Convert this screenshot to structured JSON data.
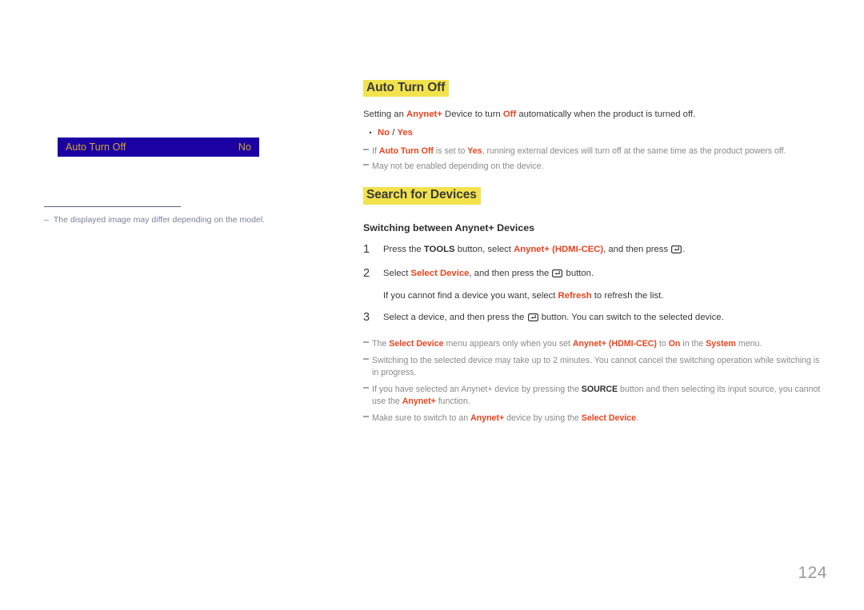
{
  "page": {
    "number": "124"
  },
  "osd_preview": {
    "row_label": "Auto Turn Off",
    "row_value": "No",
    "bg_color": "#1b01a3",
    "text_color": "#d2a829",
    "caption_dash": "–",
    "caption": "The displayed image may differ depending on the model."
  },
  "sections": {
    "auto_turn_off": {
      "heading": "Auto Turn Off",
      "intro": {
        "p1": "Setting an ",
        "a1": "Anynet+",
        "p2": " Device to turn ",
        "a2": "Off",
        "p3": " automatically when the product is turned off."
      },
      "options": {
        "bullet": "•",
        "first": "No",
        "sep": " / ",
        "second": "Yes"
      },
      "notes": [
        {
          "p1": "If ",
          "a1": "Auto Turn Off",
          "p2": " is set to ",
          "a2": "Yes",
          "p3": ", running external devices will turn off at the same time as the product powers off."
        },
        {
          "p1": "May not be enabled depending on the device.",
          "a1": "",
          "p2": "",
          "a2": "",
          "p3": ""
        }
      ]
    },
    "search_for_devices": {
      "heading": "Search for Devices",
      "subheading": "Switching between Anynet+ Devices",
      "steps": [
        {
          "num": "1",
          "p1": "Press the ",
          "b1": "TOOLS",
          "p2": " button, select ",
          "a1": "Anynet+ (HDMI-CEC)",
          "p3": ", and then press ",
          "icon": "enter-key-icon",
          "p4": "."
        },
        {
          "num": "2",
          "p1": "Select ",
          "b1": "",
          "p2": "",
          "a1": "Select Device",
          "p3": ", and then press the ",
          "icon": "enter-key-icon",
          "p4": " button."
        },
        {
          "num": "3",
          "p1": "Select a device, and then press the ",
          "b1": "",
          "p2": "",
          "a1": "",
          "p3": "",
          "icon": "enter-key-icon",
          "p4": " button. You can switch to the selected device."
        }
      ],
      "step2_sub": {
        "p1": "If you cannot find a device you want, select ",
        "a1": "Refresh",
        "p2": " to refresh the list."
      },
      "notes": [
        {
          "p1": "The ",
          "a1": "Select Device",
          "p2": " menu appears only when you set ",
          "a2": "Anynet+ (HDMI-CEC)",
          "p3": " to ",
          "a3": "On",
          "p4": " in the ",
          "a4": "System",
          "p5": " menu."
        },
        {
          "p1": "Switching to the selected device may take up to 2 minutes. You cannot cancel the switching operation while switching is in progress.",
          "a1": "",
          "p2": "",
          "a2": "",
          "p3": "",
          "a3": "",
          "p4": "",
          "a4": "",
          "p5": ""
        },
        {
          "p1": "If you have selected an Anynet+ device by pressing the ",
          "b1": "SOURCE",
          "p2": " button and then selecting its input source, you cannot use the ",
          "a2": "Anynet+",
          "p3": " function.",
          "a3": "",
          "p4": "",
          "a4": "",
          "p5": ""
        },
        {
          "p1": "Make sure to switch to an ",
          "a1": "Anynet+",
          "p2": " device by using the ",
          "a2": "Select Device",
          "p3": ".",
          "a3": "",
          "p4": "",
          "a4": "",
          "p5": ""
        }
      ]
    }
  },
  "colors": {
    "accent_red": "#e8441f",
    "highlight_yellow": "#f2e24e",
    "osd_blue": "#1b01a3",
    "osd_gold": "#d2a829",
    "note_gray": "#8a8a8a"
  }
}
